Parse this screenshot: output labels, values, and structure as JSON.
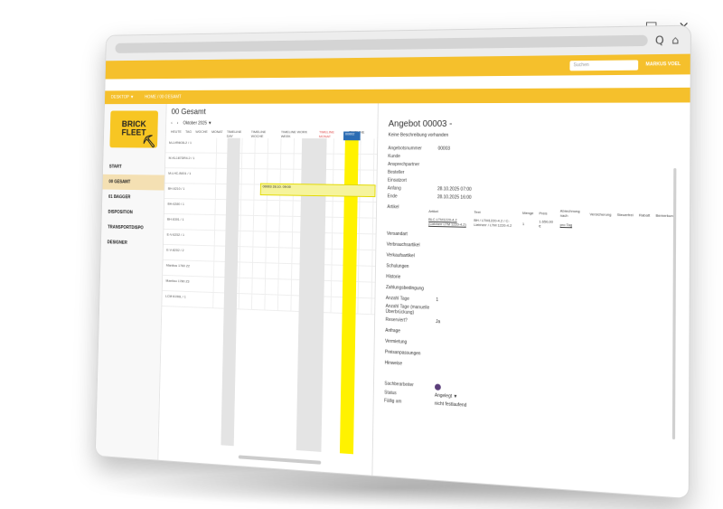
{
  "window": {
    "controls": "_ □ ×"
  },
  "browser": {
    "search_glyph": "Q",
    "home_glyph": "⌂"
  },
  "topbar": {
    "search_placeholder": "Suchen",
    "user_name": "MARKUS VOEL"
  },
  "subbar": {
    "left": "DESKTOP ▼",
    "crumb": "HOME / 00 GESAMT"
  },
  "sidebar": {
    "logo_line1": "BRICK",
    "logo_line2": "FLEET",
    "items": [
      {
        "label": "START",
        "active": false
      },
      {
        "label": "00 GESAMT",
        "active": true
      },
      {
        "label": "01 BAGGER",
        "active": false
      },
      {
        "label": "DISPOSITION",
        "active": false
      },
      {
        "label": "TRANSPORTDISPO",
        "active": false
      },
      {
        "label": "DESIGNER",
        "active": false
      }
    ]
  },
  "calendar": {
    "title": "00 Gesamt",
    "month": "Oktober 2025 ▼",
    "views": [
      "HEUTE",
      "TAG",
      "WOCHE",
      "MONAT",
      "TIMELINE DAY",
      "TIMELINE WOCHE",
      "TIMELINE WORK WEEK",
      "TIMELINE MONAT",
      "TIMELINE JAHR"
    ],
    "rows": [
      "M-LVR603L2 / 1",
      "M-KL187DR4.2 / 1",
      "M-LHC-B001 / 1",
      "BH-6210 / 1",
      "BH-6280 / 1",
      "BH-6301 / 1",
      "E-V-6252 / 1",
      "E-V-8202 / 2",
      "Manitou 1760 Z2",
      "Manitou 1780 Z3",
      "LCM 6196L / 1"
    ],
    "event_yellow": {
      "title": "00003",
      "sub": "28.10. 09:00"
    },
    "event_blue": {
      "title": "00002"
    }
  },
  "detail": {
    "title": "Angebot 00003 -",
    "description": "Keine Beschreibung vorhanden",
    "fields": [
      {
        "label": "Angebotsnummer",
        "value": "00003"
      },
      {
        "label": "Kunde",
        "value": ""
      },
      {
        "label": "Ansprechpartner",
        "value": ""
      },
      {
        "label": "Besteller",
        "value": ""
      },
      {
        "label": "Einsatzort",
        "value": ""
      },
      {
        "label": "Anfang",
        "value": "28.10.2025 07:00"
      },
      {
        "label": "Ende",
        "value": "28.10.2025 16:00"
      }
    ],
    "artikel_label": "Artikel",
    "artikel_headers": [
      "Artikel",
      "Text",
      "Menge",
      "Preis",
      "Abrechnung nach",
      "Versicherung",
      "Steuerfrei",
      "Rabatt",
      "Bemerkung"
    ],
    "artikel_row": {
      "artikel": "BLC-LTM1220-4.2 (Liebherr LTM 1220-4.2)",
      "text": "BH / LTM1220-4.2 / C-Liebherr / LTM 1220-4.2",
      "menge": "1",
      "preis": "1.650,00 €",
      "abrechnung": "pro Tag"
    },
    "sections": [
      "Versandart",
      "Verbrauchsartikel",
      "Verkaufsartikel",
      "Schulungen",
      "Historie",
      "Zahlungsbedingung"
    ],
    "anzahl_tage": {
      "label": "Anzahl Tage",
      "value": "1"
    },
    "anzahl_manuell": {
      "label": "Anzahl Tage (manuelle Überbrückung)",
      "value": ""
    },
    "reserviert": {
      "label": "Reserviert?",
      "value": "Ja"
    },
    "sections2": [
      "Anfrage",
      "Vermietung",
      "Preisanpassungen",
      "Hinweise"
    ],
    "sachbearbeiter_label": "Sachbearbeiter",
    "status": {
      "label": "Status",
      "value": "Angelegt ▼"
    },
    "faellig": {
      "label": "Fällig am",
      "value": "nicht festlaufend"
    }
  }
}
